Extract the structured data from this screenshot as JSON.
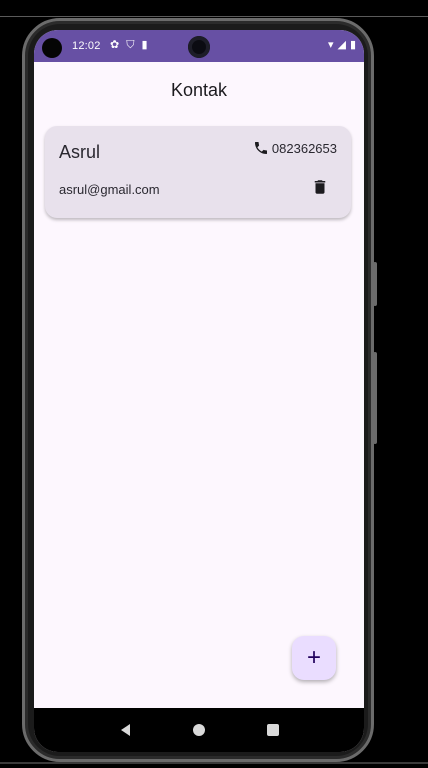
{
  "status_bar": {
    "time": "12:02",
    "left_icons": [
      "settings-icon",
      "shield-icon",
      "sim-icon"
    ],
    "right_icons": [
      "wifi-icon",
      "signal-icon",
      "battery-icon"
    ]
  },
  "app_bar": {
    "title": "Kontak"
  },
  "contacts": [
    {
      "name": "Asrul",
      "phone": "082362653",
      "email": "asrul@gmail.com"
    }
  ],
  "icons": {
    "phone": "phone-icon",
    "delete": "trash-icon",
    "add": "plus-icon"
  },
  "fab": {
    "label": "+"
  },
  "colors": {
    "status_bar": "#6750a4",
    "background": "#fdf7fe",
    "card": "#e8e1ec",
    "fab": "#eaddff"
  }
}
